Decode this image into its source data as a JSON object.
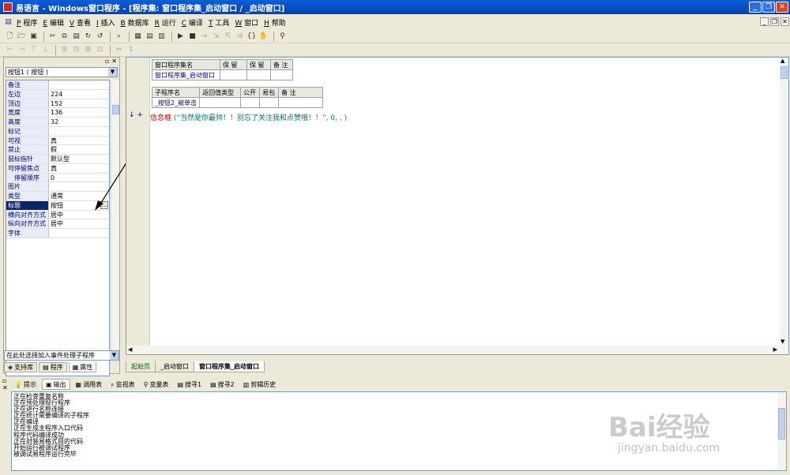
{
  "window": {
    "title": "易语言 - Windows窗口程序 - [程序集: 窗口程序集_启动窗口 / _启动窗口]",
    "controls": {
      "minimize": "_",
      "restore": "❐",
      "close": "✕"
    }
  },
  "menu": [
    {
      "key": "P",
      "label": "程序"
    },
    {
      "key": "E",
      "label": "编辑"
    },
    {
      "key": "V",
      "label": "查看"
    },
    {
      "key": "I",
      "label": "插入"
    },
    {
      "key": "B",
      "label": "数据库"
    },
    {
      "key": "R",
      "label": "运行"
    },
    {
      "key": "C",
      "label": "编译"
    },
    {
      "key": "T",
      "label": "工具"
    },
    {
      "key": "W",
      "label": "窗口"
    },
    {
      "key": "H",
      "label": "帮助"
    }
  ],
  "left_panel": {
    "selector": "按钮1 ( 按钮 )",
    "properties": [
      {
        "name": "备注",
        "value": ""
      },
      {
        "name": "左边",
        "value": "224"
      },
      {
        "name": "顶边",
        "value": "152"
      },
      {
        "name": "宽度",
        "value": "136"
      },
      {
        "name": "高度",
        "value": "32"
      },
      {
        "name": "标记",
        "value": ""
      },
      {
        "name": "可视",
        "value": "真"
      },
      {
        "name": "禁止",
        "value": "假"
      },
      {
        "name": "鼠标指针",
        "value": "默认型"
      },
      {
        "name": "可停留焦点",
        "value": "真"
      },
      {
        "name": "停留顺序",
        "value": "0"
      },
      {
        "name": "图片",
        "value": ""
      },
      {
        "name": "类型",
        "value": "通常"
      },
      {
        "name": "标题",
        "value": "按钮"
      },
      {
        "name": "横向对齐方式",
        "value": "居中"
      },
      {
        "name": "纵向对齐方式",
        "value": "居中"
      },
      {
        "name": "字体",
        "value": ""
      }
    ],
    "event_selector": "在此处选择加入事件处理子程序",
    "tabs": [
      "支持库",
      "程序",
      "属性"
    ]
  },
  "editor": {
    "assembly_table": {
      "headers": [
        "窗口程序集名",
        "保 留",
        "保 留",
        "备 注"
      ],
      "row": [
        "窗口程序集_启动窗口",
        "",
        "",
        ""
      ]
    },
    "sub_table": {
      "headers": [
        "子程序名",
        "返回值类型",
        "公开",
        "易包",
        "备 注"
      ],
      "row": [
        "_按钮2_被单击",
        "",
        "",
        "",
        ""
      ]
    },
    "code_line": {
      "marker": "↓ +",
      "func": "信息框",
      "args": " (“当然是你最帅！！别忘了关注我和点赞哦！！”, 0, , )"
    }
  },
  "doc_tabs": [
    "起始页",
    "_启动窗口",
    "窗口程序集_启动窗口"
  ],
  "output_tabs": [
    "提示",
    "输出",
    "调用表",
    "监视表",
    "变量表",
    "搜寻1",
    "搜寻2",
    "剪辑历史"
  ],
  "output_lines": [
    "正在检查重复名称",
    "正在预处理现行程序",
    "正在进行名称连接",
    "正在统计需要编译的子程序",
    "正在编译",
    "正在生成主程序入口代码",
    "程序代码编译成功",
    "正在封装易格式目的代码",
    "开始运行被调试程序",
    "被调试易程序运行完毕"
  ],
  "watermark": {
    "brand": "Bai经验",
    "url": "jingyan.baidu.com"
  }
}
